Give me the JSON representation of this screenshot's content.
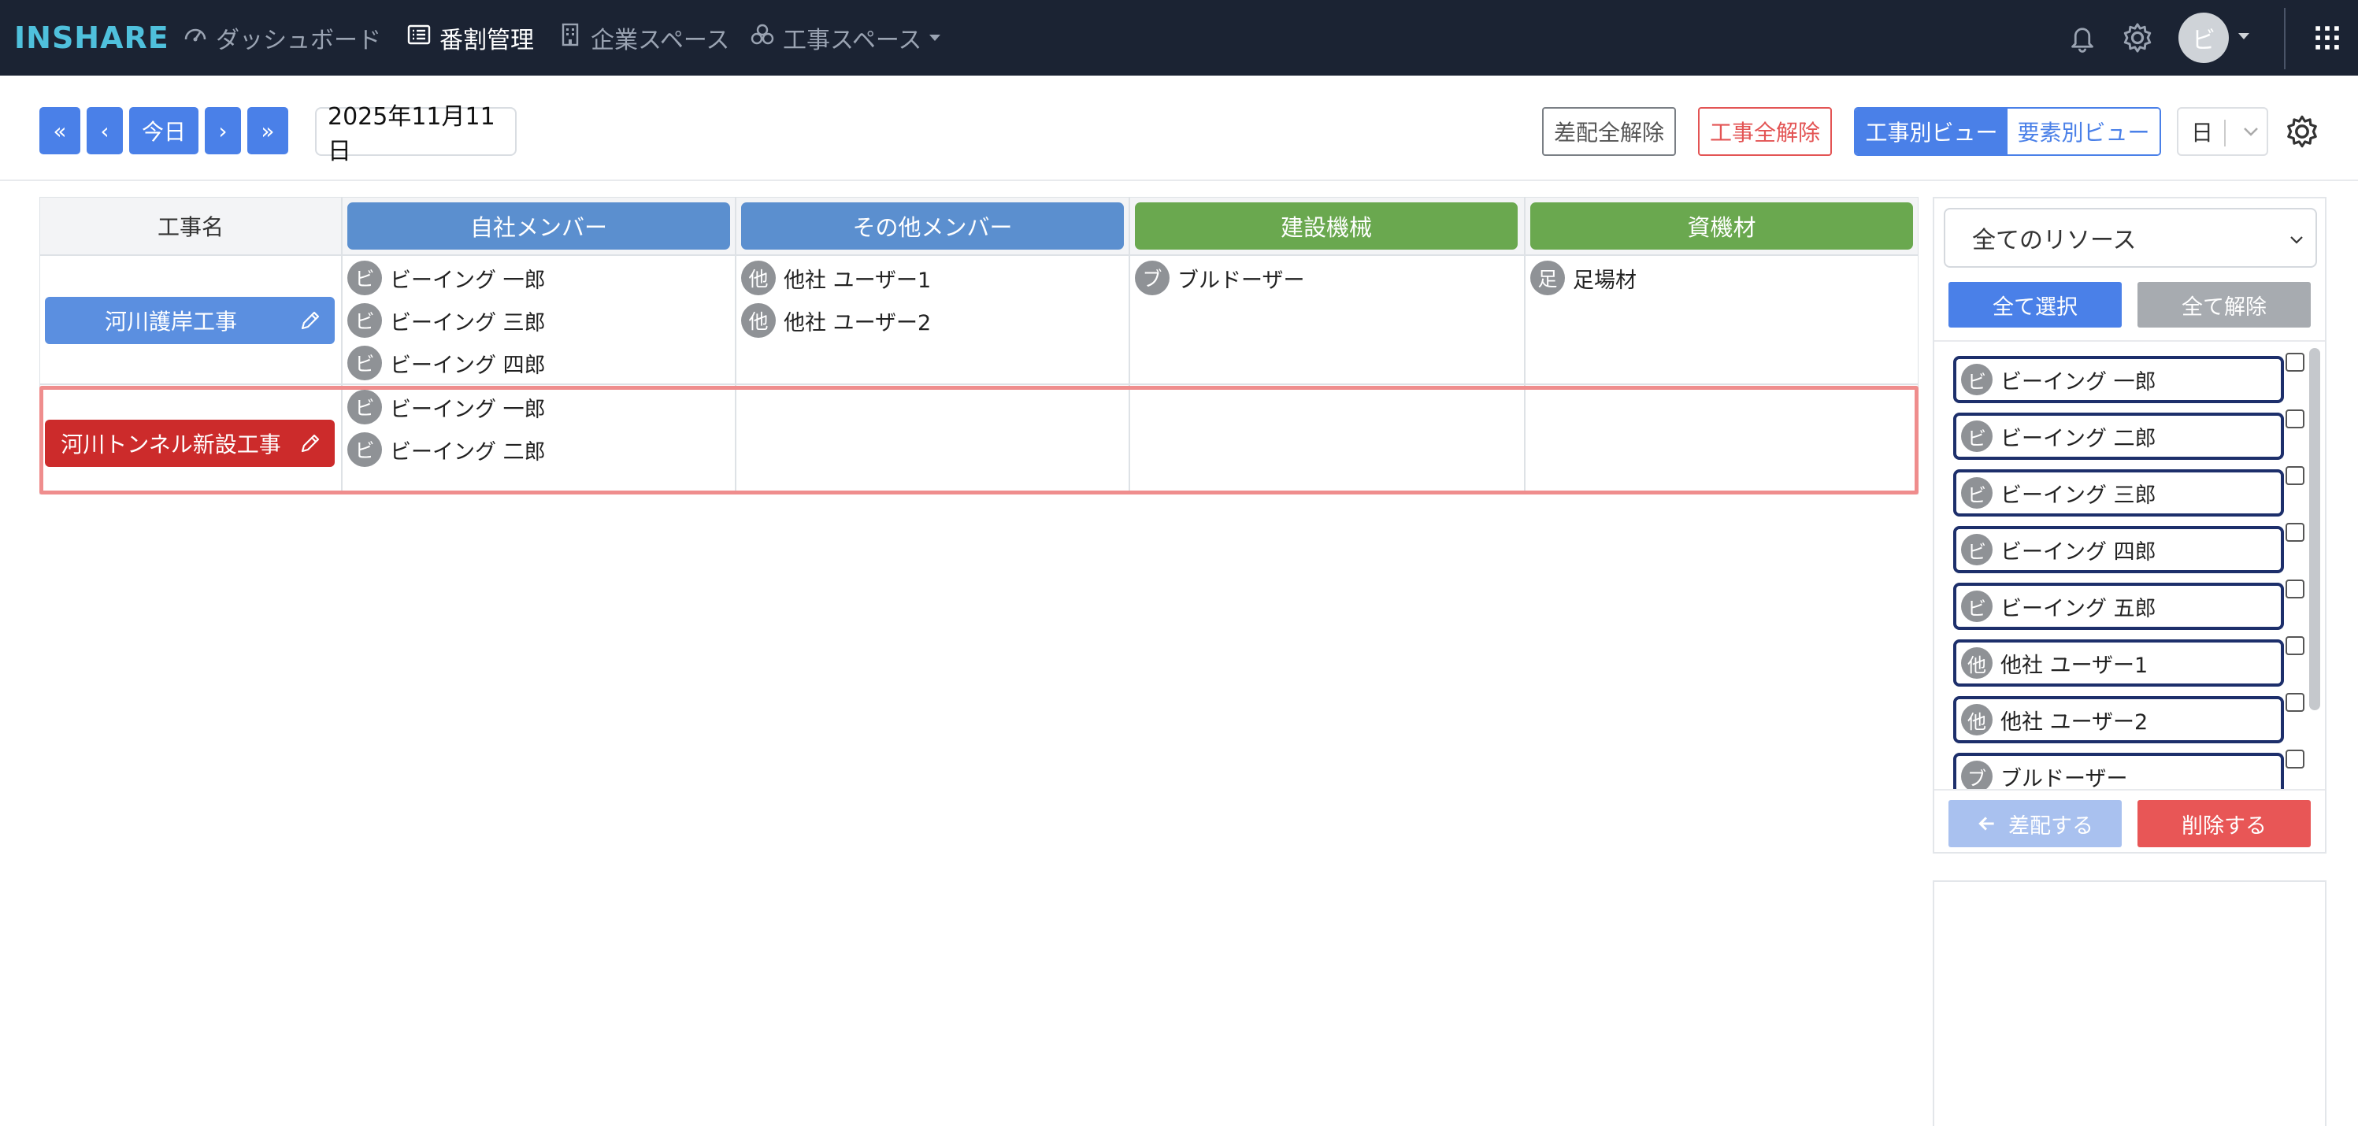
{
  "app": {
    "logo": "INSHARE"
  },
  "nav": {
    "items": [
      {
        "label": "ダッシュボード",
        "icon": "dashboard-icon"
      },
      {
        "label": "番割管理",
        "icon": "list-icon",
        "active": true
      },
      {
        "label": "企業スペース",
        "icon": "building-icon"
      },
      {
        "label": "工事スペース",
        "icon": "boxes-icon",
        "dropdown": true
      }
    ],
    "avatar": "ビ"
  },
  "toolbar": {
    "first": "«",
    "prev": "‹",
    "today": "今日",
    "next": "›",
    "last": "»",
    "date": "2025年11月11日",
    "clear_assign": "差配全解除",
    "clear_project": "工事全解除",
    "view_project": "工事別ビュー",
    "view_element": "要素別ビュー",
    "unit": "日"
  },
  "grid": {
    "headers": {
      "name": "工事名",
      "own_members": "自社メンバー",
      "other_members": "その他メンバー",
      "machines": "建設機械",
      "materials": "資機材"
    },
    "rows": [
      {
        "project": "河川護岸工事",
        "own": [
          {
            "chip": "ビ",
            "name": "ビーイング 一郎"
          },
          {
            "chip": "ビ",
            "name": "ビーイング 三郎"
          },
          {
            "chip": "ビ",
            "name": "ビーイング 四郎"
          }
        ],
        "other": [
          {
            "chip": "他",
            "name": "他社 ユーザー1"
          },
          {
            "chip": "他",
            "name": "他社 ユーザー2"
          }
        ],
        "machines": [
          {
            "chip": "ブ",
            "name": "ブルドーザー"
          }
        ],
        "materials": [
          {
            "chip": "足",
            "name": "足場材"
          }
        ]
      },
      {
        "project": "河川トンネル新設工事",
        "own": [
          {
            "chip": "ビ",
            "name": "ビーイング 一郎"
          },
          {
            "chip": "ビ",
            "name": "ビーイング 二郎"
          }
        ],
        "other": [],
        "machines": [],
        "materials": []
      }
    ]
  },
  "panel": {
    "filter": "全てのリソース",
    "select_all": "全て選択",
    "clear_all": "全て解除",
    "resources": [
      {
        "chip": "ビ",
        "name": "ビーイング 一郎"
      },
      {
        "chip": "ビ",
        "name": "ビーイング 二郎"
      },
      {
        "chip": "ビ",
        "name": "ビーイング 三郎"
      },
      {
        "chip": "ビ",
        "name": "ビーイング 四郎"
      },
      {
        "chip": "ビ",
        "name": "ビーイング 五郎"
      },
      {
        "chip": "他",
        "name": "他社 ユーザー1"
      },
      {
        "chip": "他",
        "name": "他社 ユーザー2"
      },
      {
        "chip": "ブ",
        "name": "ブルドーザー"
      }
    ],
    "assign": "差配する",
    "delete": "削除する"
  },
  "colors": {
    "nav_bg": "#1b2333",
    "logo": "#4fc0dc",
    "primary": "#4a80e8",
    "header_blue": "#5b8fcf",
    "header_green": "#6aa84f",
    "project_blue": "#5b8fe0",
    "project_red": "#cc2b2b",
    "danger": "#e85656",
    "highlight": "#ef8d8d"
  }
}
